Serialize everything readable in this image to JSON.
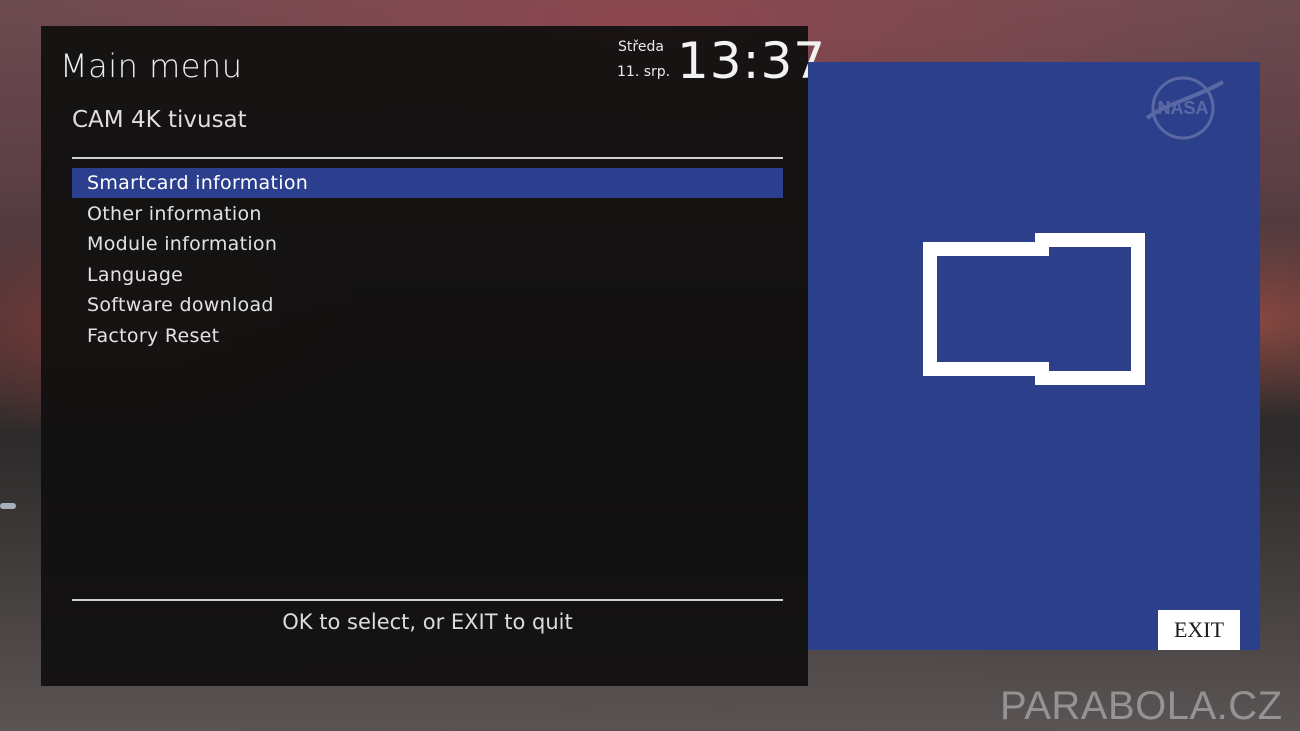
{
  "menu": {
    "title": "Main menu",
    "subtitle": "CAM 4K tivusat",
    "items": [
      {
        "label": "Smartcard information",
        "selected": true
      },
      {
        "label": "Other information",
        "selected": false
      },
      {
        "label": "Module information",
        "selected": false
      },
      {
        "label": "Language",
        "selected": false
      },
      {
        "label": "Software download",
        "selected": false
      },
      {
        "label": "Factory Reset",
        "selected": false
      }
    ],
    "hint": "OK to select, or EXIT to quit"
  },
  "clock": {
    "day": "Středa",
    "date": "11. srp.",
    "time": "13:37"
  },
  "preview": {
    "logo_text": "NASA",
    "icon": "smartcard-icon",
    "exit_label": "EXIT"
  },
  "watermark": "PARABOLA.CZ",
  "colors": {
    "selection": "#2b3f8e",
    "preview_background": "#2c3f8b",
    "panel_background": "#100f0f"
  }
}
